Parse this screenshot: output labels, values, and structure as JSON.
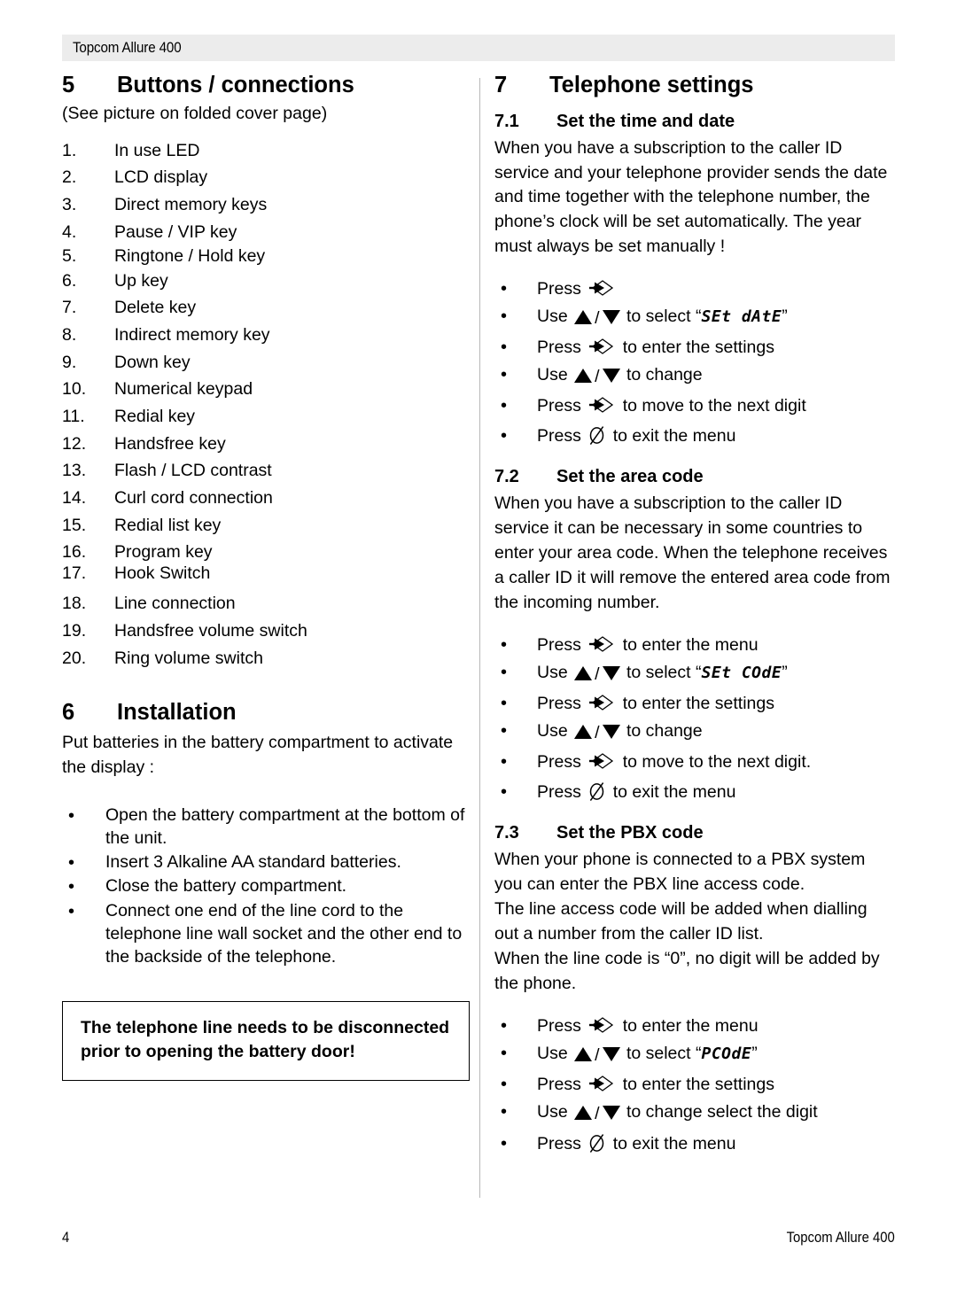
{
  "header": {
    "title": "Topcom Allure 400"
  },
  "footer": {
    "page_number": "4",
    "book_title": "Topcom Allure 400"
  },
  "left_column": {
    "section5": {
      "number": "5",
      "title": "Buttons / connections",
      "subtitle": "(See picture on folded cover page)",
      "items": [
        {
          "n": "1.",
          "label": "In use LED"
        },
        {
          "n": "2.",
          "label": "LCD display"
        },
        {
          "n": "3.",
          "label": "Direct memory keys"
        },
        {
          "n": "4.",
          "label": "Pause / VIP key"
        },
        {
          "n": "5.",
          "label": "Ringtone / Hold key"
        },
        {
          "n": "6.",
          "label": "Up key"
        },
        {
          "n": "7.",
          "label": "Delete key"
        },
        {
          "n": "8.",
          "label": "Indirect memory key"
        },
        {
          "n": "9.",
          "label": "Down key"
        },
        {
          "n": "10.",
          "label": "Numerical keypad"
        },
        {
          "n": "11.",
          "label": "Redial key"
        },
        {
          "n": "12.",
          "label": "Handsfree key"
        },
        {
          "n": "13.",
          "label": "Flash / LCD contrast"
        },
        {
          "n": "14.",
          "label": "Curl cord connection"
        },
        {
          "n": "15.",
          "label": "Redial list key"
        },
        {
          "n": "16.",
          "label": "Program key"
        },
        {
          "n": "17.",
          "label": "Hook Switch"
        },
        {
          "n": "18.",
          "label": "Line connection"
        },
        {
          "n": "19.",
          "label": "Handsfree volume switch"
        },
        {
          "n": "20.",
          "label": "Ring volume switch"
        }
      ]
    },
    "section6": {
      "number": "6",
      "title": "Installation",
      "intro": "Put batteries in the battery compartment to activate the display :",
      "bullet_char": "•",
      "bullets": [
        "Open the battery compartment at the bottom of the unit.",
        "Insert 3 Alkaline AA standard batteries.",
        "Close the battery compartment.",
        "Connect one end of the line cord to the telephone line wall socket and the other end to the backside of the telephone."
      ],
      "warning": "The telephone line needs to be disconnected prior to opening the battery door!"
    }
  },
  "right_column": {
    "section7": {
      "number": "7",
      "title": "Telephone settings"
    },
    "section71": {
      "number": "7.1",
      "title": "Set the time and date",
      "body": "When you have a subscription to the caller ID service and your telephone provider sends the date and time together with the telephone number, the phone’s clock will be set automatically. The year must always be set manually !",
      "steps": [
        {
          "pre": "Press",
          "icon": "program-key-icon",
          "post": ""
        },
        {
          "pre": "Use",
          "icon": "up-down-key-icon",
          "post": "to select “",
          "lcd": "SEt dAtE",
          "tail": "”"
        },
        {
          "pre": "Press",
          "icon": "program-key-icon",
          "post": "to enter the settings"
        },
        {
          "pre": "Use",
          "icon": "up-down-key-icon",
          "post": "to change"
        },
        {
          "pre": "Press",
          "icon": "program-key-icon",
          "post": "to move to the next digit"
        },
        {
          "pre": "Press",
          "icon": "exit-key-icon",
          "post": "to exit the menu"
        }
      ]
    },
    "section72": {
      "number": "7.2",
      "title": "Set the area code",
      "body": "When you have a subscription to the caller ID service it can be necessary in some countries to enter your area code. When the telephone receives a caller ID it will remove the entered area code from the incoming number.",
      "steps": [
        {
          "pre": "Press",
          "icon": "program-key-icon",
          "post": "to enter the menu"
        },
        {
          "pre": "Use",
          "icon": "up-down-key-icon",
          "post": "to select “",
          "lcd": "SEt COdE",
          "tail": "”"
        },
        {
          "pre": "Press",
          "icon": "program-key-icon",
          "post": "to enter the settings"
        },
        {
          "pre": "Use",
          "icon": "up-down-key-icon",
          "post": "to change"
        },
        {
          "pre": "Press",
          "icon": "program-key-icon",
          "post": "to move to the next digit."
        },
        {
          "pre": "Press",
          "icon": "exit-key-icon",
          "post": "to exit the menu"
        }
      ]
    },
    "section73": {
      "number": "7.3",
      "title": "Set the PBX code",
      "body_line1": "When your phone is connected to a PBX system you can enter the PBX line access code.",
      "body_line2": "The line access code will be added when dialling out a number from the caller ID list.",
      "body_line3": "When the line code is “0”, no digit will be added by the phone.",
      "steps": [
        {
          "pre": "Press",
          "icon": "program-key-icon",
          "post": "to enter the menu"
        },
        {
          "pre": "Use",
          "icon": "up-down-key-icon",
          "post": "to select “",
          "lcd": "PCOdE",
          "tail": "”"
        },
        {
          "pre": "Press",
          "icon": "program-key-icon",
          "post": "to enter the settings"
        },
        {
          "pre": "Use",
          "icon": "up-down-key-icon",
          "post": "to change select the digit"
        },
        {
          "pre": "Press",
          "icon": "exit-key-icon",
          "post": "to exit the menu"
        }
      ]
    }
  }
}
